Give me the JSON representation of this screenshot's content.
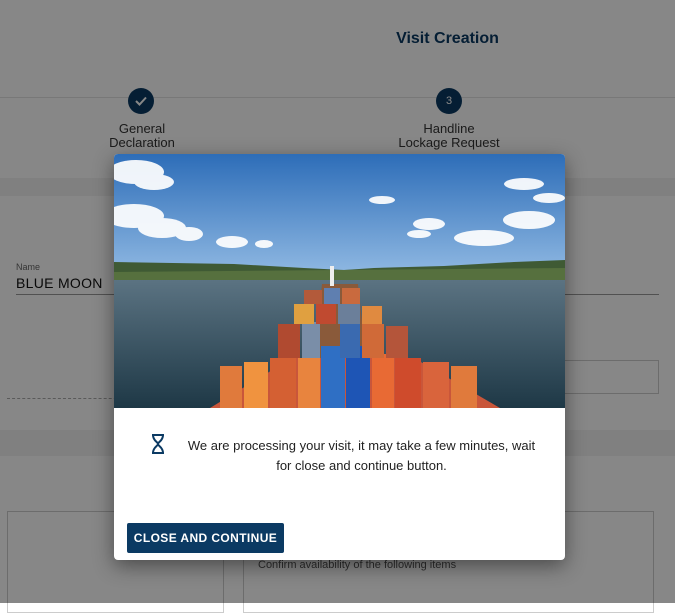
{
  "page": {
    "title": "Visit Creation"
  },
  "stepper": {
    "steps": [
      {
        "label_line1": "General",
        "label_line2": "Declaration",
        "status": "completed",
        "icon": "check-icon"
      },
      {
        "number": "3",
        "label_line1": "Handline",
        "label_line2": "Lockage Request",
        "status": "current"
      }
    ]
  },
  "form": {
    "name_label": "Name",
    "name_value": "BLUE MOON",
    "confirm_text": "Confirm availability of the following items"
  },
  "modal": {
    "image": "container-ship-canal-photo",
    "icon": "hourglass-icon",
    "message": "We are processing your visit, it may take a few minutes, wait for close and continue button.",
    "button_label": "CLOSE AND CONTINUE"
  },
  "colors": {
    "primary": "#0b3a63",
    "overlay": "rgba(0,0,0,0.47)"
  }
}
